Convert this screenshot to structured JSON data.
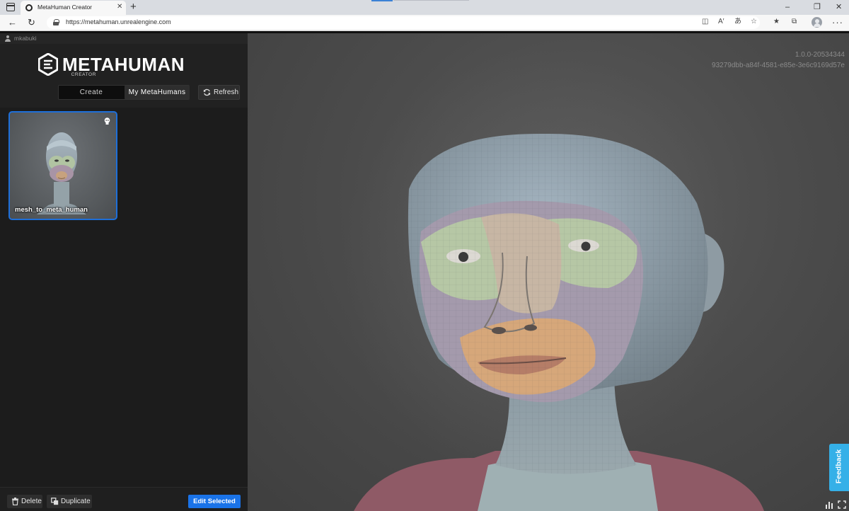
{
  "browser": {
    "tab_title": "MetaHuman Creator",
    "url": "https://metahuman.unrealengine.com",
    "new_tab_glyph": "+",
    "close_glyph": "✕"
  },
  "app": {
    "username": "mkabuki",
    "logo_text": "METAHUMAN",
    "logo_subtext": "CREATOR",
    "tabs": {
      "create": "Create",
      "my_metahumans": "My MetaHumans",
      "active": "my_metahumans"
    },
    "refresh_label": "Refresh",
    "metahumans": [
      {
        "name": "mesh_to_meta_human",
        "selected": true
      }
    ],
    "footer": {
      "delete": "Delete",
      "duplicate": "Duplicate",
      "edit_selected": "Edit Selected"
    },
    "accent": "#1a73e8"
  },
  "viewport": {
    "version": "1.0.0-20534344",
    "build_hash": "93279dbb-a84f-4581-e85e-3e6c9169d57e",
    "feedback_label": "Feedback"
  }
}
